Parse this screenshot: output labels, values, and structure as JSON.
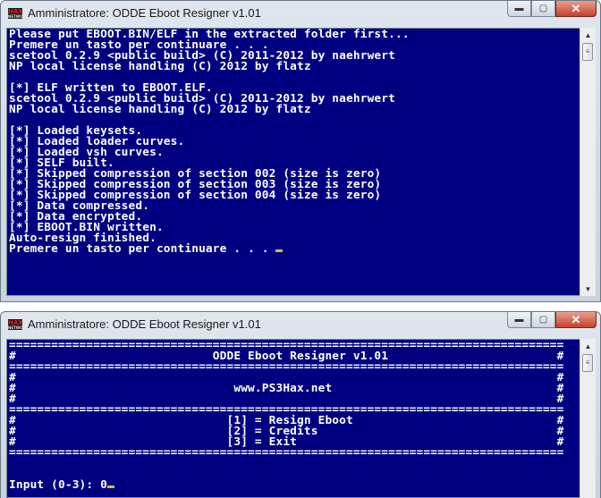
{
  "window1": {
    "title": "Amministratore:  ODDE Eboot Resigner v1.01",
    "icon": "hax-app-icon",
    "controls": {
      "minimize": "minimize-icon",
      "maximize": "maximize-icon",
      "close": "close-icon"
    },
    "lines": [
      "Please put EBOOT.BIN/ELF in the extracted folder first...",
      "Premere un tasto per continuare . . .",
      "scetool 0.2.9 <public build> (C) 2011-2012 by naehrwert",
      "NP local license handling (C) 2012 by flatz",
      "",
      "[*] ELF written to EBOOT.ELF.",
      "scetool 0.2.9 <public build> (C) 2011-2012 by naehrwert",
      "NP local license handling (C) 2012 by flatz",
      "",
      "[*] Loaded keysets.",
      "[*] Loaded loader curves.",
      "[*] Loaded vsh curves.",
      "[*] SELF built.",
      "[*] Skipped compression of section 002 (size is zero)",
      "[*] Skipped compression of section 003 (size is zero)",
      "[*] Skipped compression of section 004 (size is zero)",
      "[*] Data compressed.",
      "[*] Data encrypted.",
      "[*] EBOOT.BIN written.",
      "Auto-resign finished."
    ],
    "prompt": "Premere un tasto per continuare . . . "
  },
  "window2": {
    "title": "Amministratore:  ODDE Eboot Resigner v1.01",
    "icon": "hax-app-icon",
    "controls": {
      "minimize": "minimize-icon",
      "maximize": "maximize-icon",
      "close": "close-icon"
    },
    "lines": [
      "===============================================================================",
      "#                            ODDE Eboot Resigner v1.01                        #",
      "===============================================================================",
      "#                                                                             #",
      "#                               www.PS3Hax.net                                #",
      "#                                                                             #",
      "===============================================================================",
      "#                              [1] = Resign Eboot                             #",
      "#                              [2] = Credits                                  #",
      "#                              [3] = Exit                                     #",
      "===============================================================================",
      "",
      ""
    ],
    "prompt": "Input (0-3): 0"
  },
  "colors": {
    "console_bg": "#000080",
    "console_fg": "#ffffff",
    "cursor": "#c8c040",
    "close_button": "#c6412c"
  }
}
